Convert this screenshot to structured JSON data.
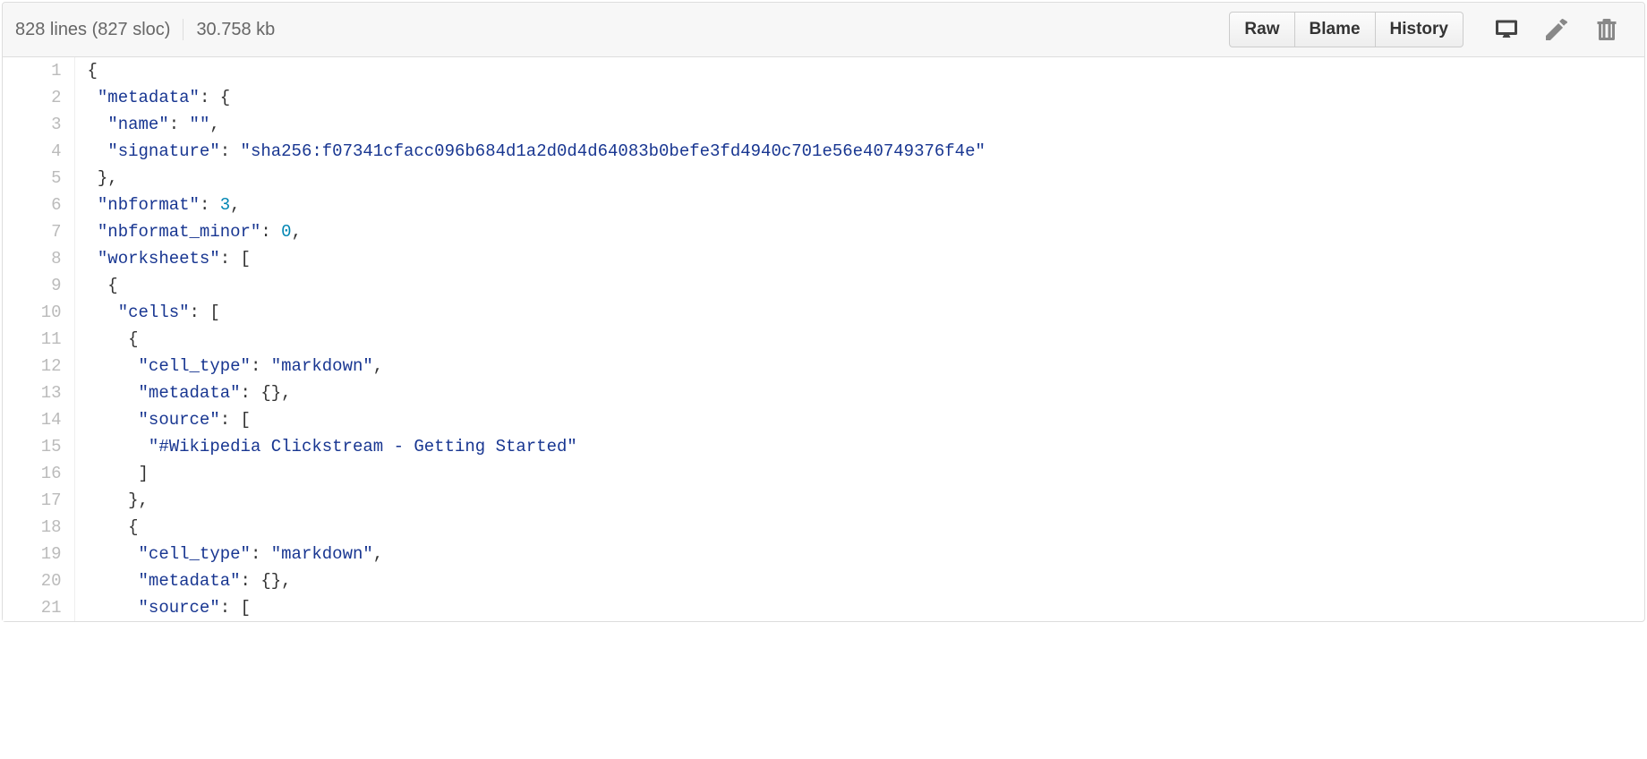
{
  "header": {
    "lines_sloc": "828 lines (827 sloc)",
    "size": "30.758 kb",
    "buttons": {
      "raw": "Raw",
      "blame": "Blame",
      "history": "History"
    }
  },
  "code": {
    "start_line": 1,
    "lines": [
      [
        {
          "t": "p",
          "v": "{"
        }
      ],
      [
        {
          "t": "p",
          "v": " "
        },
        {
          "t": "k",
          "v": "\"metadata\""
        },
        {
          "t": "p",
          "v": ": {"
        }
      ],
      [
        {
          "t": "p",
          "v": "  "
        },
        {
          "t": "k",
          "v": "\"name\""
        },
        {
          "t": "p",
          "v": ": "
        },
        {
          "t": "k",
          "v": "\"\""
        },
        {
          "t": "p",
          "v": ","
        }
      ],
      [
        {
          "t": "p",
          "v": "  "
        },
        {
          "t": "k",
          "v": "\"signature\""
        },
        {
          "t": "p",
          "v": ": "
        },
        {
          "t": "k",
          "v": "\"sha256:f07341cfacc096b684d1a2d0d4d64083b0befe3fd4940c701e56e40749376f4e\""
        }
      ],
      [
        {
          "t": "p",
          "v": " },"
        }
      ],
      [
        {
          "t": "p",
          "v": " "
        },
        {
          "t": "k",
          "v": "\"nbformat\""
        },
        {
          "t": "p",
          "v": ": "
        },
        {
          "t": "n",
          "v": "3"
        },
        {
          "t": "p",
          "v": ","
        }
      ],
      [
        {
          "t": "p",
          "v": " "
        },
        {
          "t": "k",
          "v": "\"nbformat_minor\""
        },
        {
          "t": "p",
          "v": ": "
        },
        {
          "t": "n",
          "v": "0"
        },
        {
          "t": "p",
          "v": ","
        }
      ],
      [
        {
          "t": "p",
          "v": " "
        },
        {
          "t": "k",
          "v": "\"worksheets\""
        },
        {
          "t": "p",
          "v": ": ["
        }
      ],
      [
        {
          "t": "p",
          "v": "  {"
        }
      ],
      [
        {
          "t": "p",
          "v": "   "
        },
        {
          "t": "k",
          "v": "\"cells\""
        },
        {
          "t": "p",
          "v": ": ["
        }
      ],
      [
        {
          "t": "p",
          "v": "    {"
        }
      ],
      [
        {
          "t": "p",
          "v": "     "
        },
        {
          "t": "k",
          "v": "\"cell_type\""
        },
        {
          "t": "p",
          "v": ": "
        },
        {
          "t": "k",
          "v": "\"markdown\""
        },
        {
          "t": "p",
          "v": ","
        }
      ],
      [
        {
          "t": "p",
          "v": "     "
        },
        {
          "t": "k",
          "v": "\"metadata\""
        },
        {
          "t": "p",
          "v": ": {},"
        }
      ],
      [
        {
          "t": "p",
          "v": "     "
        },
        {
          "t": "k",
          "v": "\"source\""
        },
        {
          "t": "p",
          "v": ": ["
        }
      ],
      [
        {
          "t": "p",
          "v": "      "
        },
        {
          "t": "k",
          "v": "\"#Wikipedia Clickstream - Getting Started\""
        }
      ],
      [
        {
          "t": "p",
          "v": "     ]"
        }
      ],
      [
        {
          "t": "p",
          "v": "    },"
        }
      ],
      [
        {
          "t": "p",
          "v": "    {"
        }
      ],
      [
        {
          "t": "p",
          "v": "     "
        },
        {
          "t": "k",
          "v": "\"cell_type\""
        },
        {
          "t": "p",
          "v": ": "
        },
        {
          "t": "k",
          "v": "\"markdown\""
        },
        {
          "t": "p",
          "v": ","
        }
      ],
      [
        {
          "t": "p",
          "v": "     "
        },
        {
          "t": "k",
          "v": "\"metadata\""
        },
        {
          "t": "p",
          "v": ": {},"
        }
      ],
      [
        {
          "t": "p",
          "v": "     "
        },
        {
          "t": "k",
          "v": "\"source\""
        },
        {
          "t": "p",
          "v": ": ["
        }
      ]
    ]
  }
}
